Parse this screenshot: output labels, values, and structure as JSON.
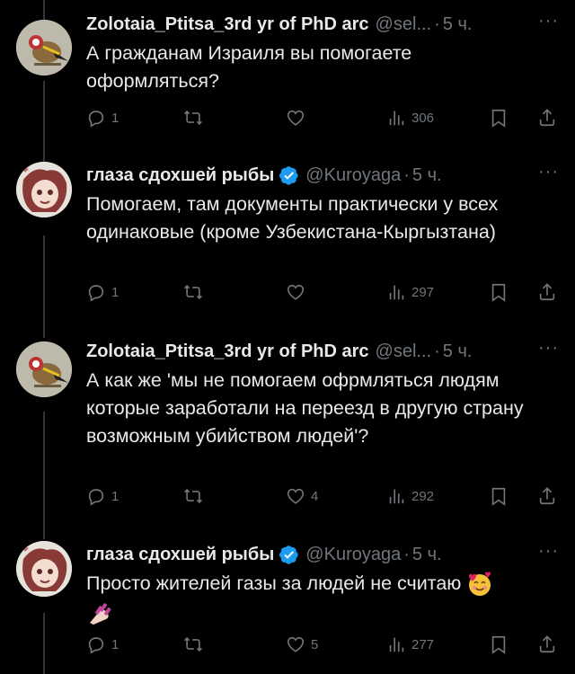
{
  "tweets": [
    {
      "name": "Zolotaia_Ptitsa_3rd yr of PhD arc",
      "handle": "@sel...",
      "time": "5 ч.",
      "text": "А гражданам Израиля вы помогаете оформляться?",
      "replies": "1",
      "retweets": "",
      "likes": "",
      "views": "306",
      "verified": false
    },
    {
      "name": "глаза сдохшей рыбы",
      "handle": "@Kuroyaga",
      "time": "5 ч.",
      "text": "Помогаем, там документы практически у всех одинаковые (кроме Узбекистана-Кыргызтана)",
      "replies": "1",
      "retweets": "",
      "likes": "",
      "views": "297",
      "verified": true
    },
    {
      "name": "Zolotaia_Ptitsa_3rd yr of PhD arc",
      "handle": "@sel...",
      "time": "5 ч.",
      "text": "А как же 'мы не помогаем офрмляться людям которые заработали на переезд в другую страну возможным убийством людей'?",
      "replies": "1",
      "retweets": "",
      "likes": "4",
      "views": "292",
      "verified": false
    },
    {
      "name": "глаза сдохшей рыбы",
      "handle": "@Kuroyaga",
      "time": "5 ч.",
      "text": "Просто жителей газы за людей не считаю",
      "replies": "1",
      "retweets": "",
      "likes": "5",
      "views": "277",
      "verified": true
    }
  ],
  "icons": {
    "reply": "speech-bubble-icon",
    "retweet": "retweet-icon",
    "like": "heart-icon",
    "views": "bar-chart-icon",
    "bookmark": "bookmark-icon",
    "share": "share-icon",
    "more": "more-dots-icon",
    "verified": "verified-badge-icon"
  },
  "colors": {
    "background": "#000000",
    "primary_text": "#e7e9ea",
    "secondary_text": "#71767b",
    "verified_blue": "#1d9bf0"
  }
}
